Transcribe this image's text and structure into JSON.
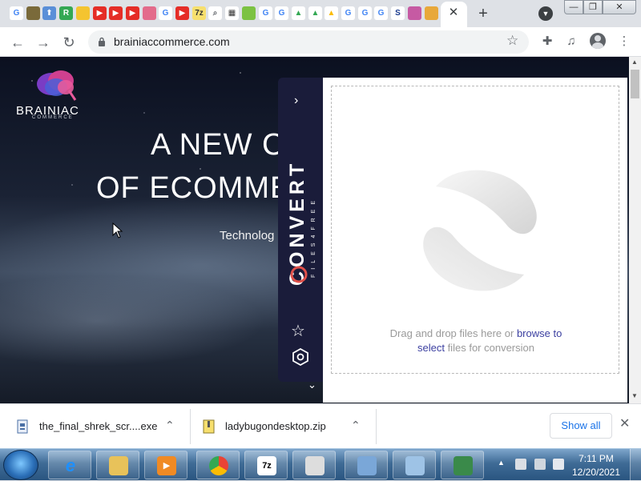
{
  "browser": {
    "tab_icons": [
      {
        "name": "google-icon",
        "glyph": "G",
        "color": "#4285f4",
        "bg": "#ffffff"
      },
      {
        "name": "shield-extension-icon",
        "glyph": "",
        "color": "#ffffff",
        "bg": "#7a6a3a"
      },
      {
        "name": "upload-icon",
        "glyph": "⬆",
        "color": "#ffffff",
        "bg": "#5a8fd8"
      },
      {
        "name": "extension-icon",
        "glyph": "R",
        "color": "#ffffff",
        "bg": "#34a853"
      },
      {
        "name": "docs-icon",
        "glyph": "",
        "color": "#ffffff",
        "bg": "#f4c430"
      },
      {
        "name": "youtube-icon",
        "glyph": "▶",
        "color": "#ffffff",
        "bg": "#e52d27"
      },
      {
        "name": "youtube-icon",
        "glyph": "▶",
        "color": "#ffffff",
        "bg": "#e52d27"
      },
      {
        "name": "youtube-icon",
        "glyph": "▶",
        "color": "#ffffff",
        "bg": "#e52d27"
      },
      {
        "name": "photo-icon",
        "glyph": "",
        "color": "#ffffff",
        "bg": "#e36b8b"
      },
      {
        "name": "google-icon",
        "glyph": "G",
        "color": "#4285f4",
        "bg": "#ffffff"
      },
      {
        "name": "youtube-icon",
        "glyph": "▶",
        "color": "#ffffff",
        "bg": "#e52d27"
      },
      {
        "name": "7zip-icon",
        "glyph": "7z",
        "color": "#333333",
        "bg": "#f7df6e"
      },
      {
        "name": "search-icon",
        "glyph": "⌕",
        "color": "#5f6368",
        "bg": "#ffffff"
      },
      {
        "name": "film-icon",
        "glyph": "▦",
        "color": "#333333",
        "bg": "#ffffff"
      },
      {
        "name": "android-icon",
        "glyph": "",
        "color": "#ffffff",
        "bg": "#7cc242"
      },
      {
        "name": "google-icon",
        "glyph": "G",
        "color": "#4285f4",
        "bg": "#ffffff"
      },
      {
        "name": "google-icon",
        "glyph": "G",
        "color": "#4285f4",
        "bg": "#ffffff"
      },
      {
        "name": "drive-icon",
        "glyph": "▲",
        "color": "#34a853",
        "bg": "#ffffff"
      },
      {
        "name": "drive-icon",
        "glyph": "▲",
        "color": "#34a853",
        "bg": "#ffffff"
      },
      {
        "name": "drive-icon",
        "glyph": "▲",
        "color": "#fbbc05",
        "bg": "#ffffff"
      },
      {
        "name": "google-icon",
        "glyph": "G",
        "color": "#4285f4",
        "bg": "#ffffff"
      },
      {
        "name": "google-icon",
        "glyph": "G",
        "color": "#4285f4",
        "bg": "#ffffff"
      },
      {
        "name": "google-icon",
        "glyph": "G",
        "color": "#4285f4",
        "bg": "#ffffff"
      },
      {
        "name": "s-icon",
        "glyph": "S",
        "color": "#1a3c8f",
        "bg": "#ffffff"
      },
      {
        "name": "bird-icon",
        "glyph": "",
        "color": "#ffffff",
        "bg": "#c65aa3"
      },
      {
        "name": "gift-icon",
        "glyph": "",
        "color": "#ffffff",
        "bg": "#e8a83a"
      }
    ],
    "active_tab_close": "✕",
    "new_tab": "+",
    "tab_search": "▼",
    "window_controls": {
      "minimize": "—",
      "maximize": "❐",
      "close": "✕"
    },
    "url": "brainiaccommerce.com"
  },
  "page": {
    "logo_text": "BRAINIAC",
    "logo_sub": "COMMERCE",
    "hero_line1": "A NEW C",
    "hero_line2": "OF ECOMME",
    "hero_sub": "Technolog"
  },
  "convert": {
    "brand_main": "CONVERT",
    "brand_sub": "FILES4FREE",
    "drop_text_1": "Drag and drop files here or ",
    "drop_link_1": "browse to",
    "drop_link_2": "select",
    "drop_text_2": " files for conversion",
    "accent_color": "#1a1c3a"
  },
  "downloads": {
    "items": [
      {
        "name": "the_final_shrek_scr....exe"
      },
      {
        "name": "ladybugondesktop.zip"
      }
    ],
    "show_all": "Show all"
  },
  "taskbar": {
    "time": "7:11 PM",
    "date": "12/20/2021",
    "apps": [
      {
        "name": "internet-explorer-icon",
        "glyph": "e",
        "color": "#1e90ff",
        "bg": "transparent"
      },
      {
        "name": "file-explorer-icon",
        "glyph": "",
        "color": "#fff",
        "bg": "#e8c25a"
      },
      {
        "name": "media-player-icon",
        "glyph": "▶",
        "color": "#ffffff",
        "bg": "#f08a24"
      },
      {
        "name": "chrome-icon",
        "glyph": "",
        "color": "#fff",
        "bg": "transparent"
      },
      {
        "name": "7zip-icon",
        "glyph": "7z",
        "color": "#000000",
        "bg": "#ffffff"
      },
      {
        "name": "app-icon",
        "glyph": "",
        "color": "#fff",
        "bg": "#dddddd"
      },
      {
        "name": "network-icon",
        "glyph": "",
        "color": "#fff",
        "bg": "#7aa7d8"
      },
      {
        "name": "control-panel-icon",
        "glyph": "",
        "color": "#fff",
        "bg": "#9ec3e6"
      },
      {
        "name": "desktop-icon",
        "glyph": "",
        "color": "#fff",
        "bg": "#3a8a4a"
      }
    ]
  }
}
